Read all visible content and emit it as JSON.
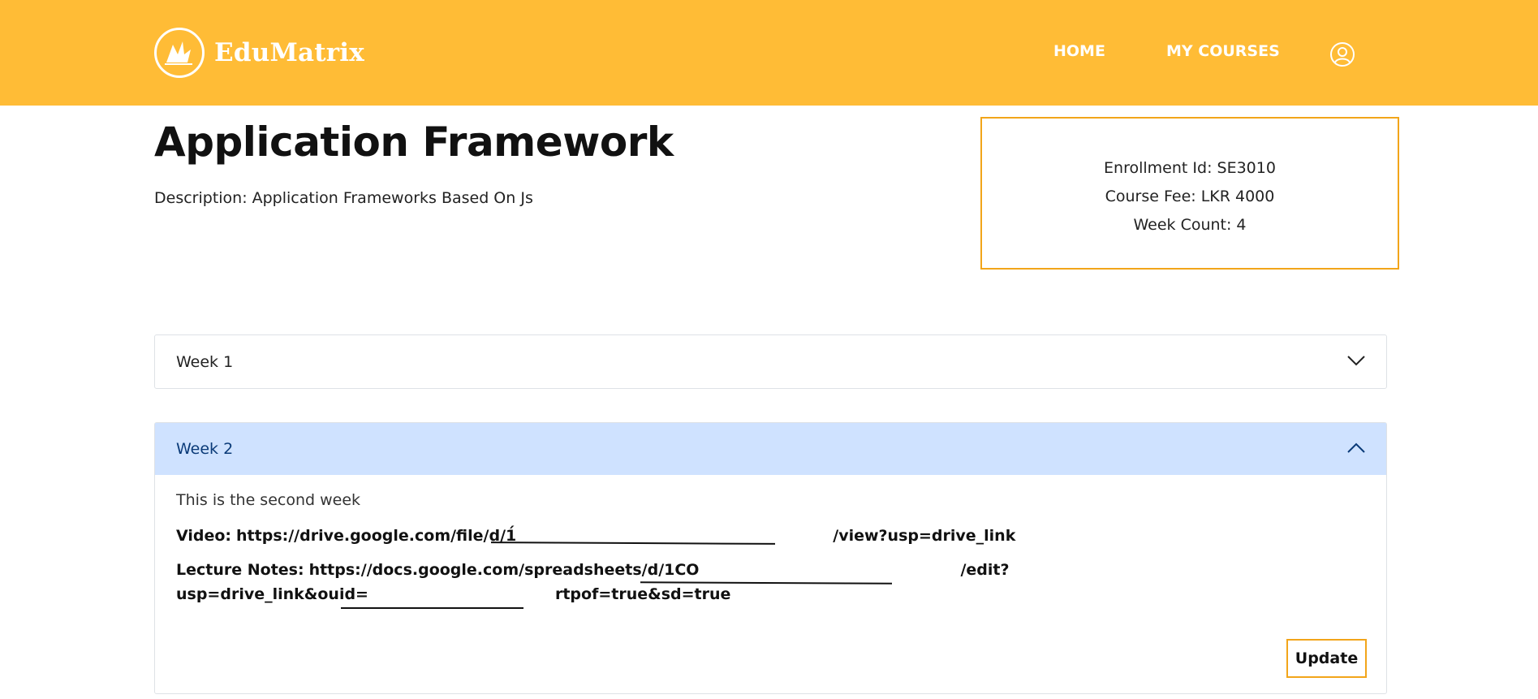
{
  "header": {
    "brand": "EduMatrix",
    "nav": {
      "home": "HOME",
      "my_courses": "MY COURSES"
    },
    "icons": {
      "logo": "bird-logo-icon",
      "profile": "user-circle-icon"
    },
    "bg_color": "#FFBC36"
  },
  "course": {
    "title": "Application Framework",
    "description_label": "Description:",
    "description": "Application Frameworks Based On Js"
  },
  "info": {
    "enrollment": "Enrollment Id: SE3010",
    "fee": "Course Fee: LKR 4000",
    "weeks": "Week Count: 4",
    "border_color": "#F2A51A"
  },
  "weeks": [
    {
      "title": "Week 1",
      "expanded": false,
      "icon": "chevron-down-icon"
    },
    {
      "title": "Week 2",
      "expanded": true,
      "icon": "chevron-up-icon",
      "description": "This is the second week",
      "video_label": "Video:",
      "video_link_start": "https://drive.google.com/file/d/1́",
      "video_link_end": "/view?usp=drive_link",
      "notes_label": "Lecture Notes:",
      "notes_link_start": "https://docs.google.com/spreadsheets/d/1CO",
      "notes_link_end": "/edit?",
      "notes_line2_start": "usp=drive_link&ouid=",
      "notes_line2_end": "rtpof=true&sd=true",
      "update_label": "Update",
      "highlight_color": "#CFE2FF"
    }
  ]
}
